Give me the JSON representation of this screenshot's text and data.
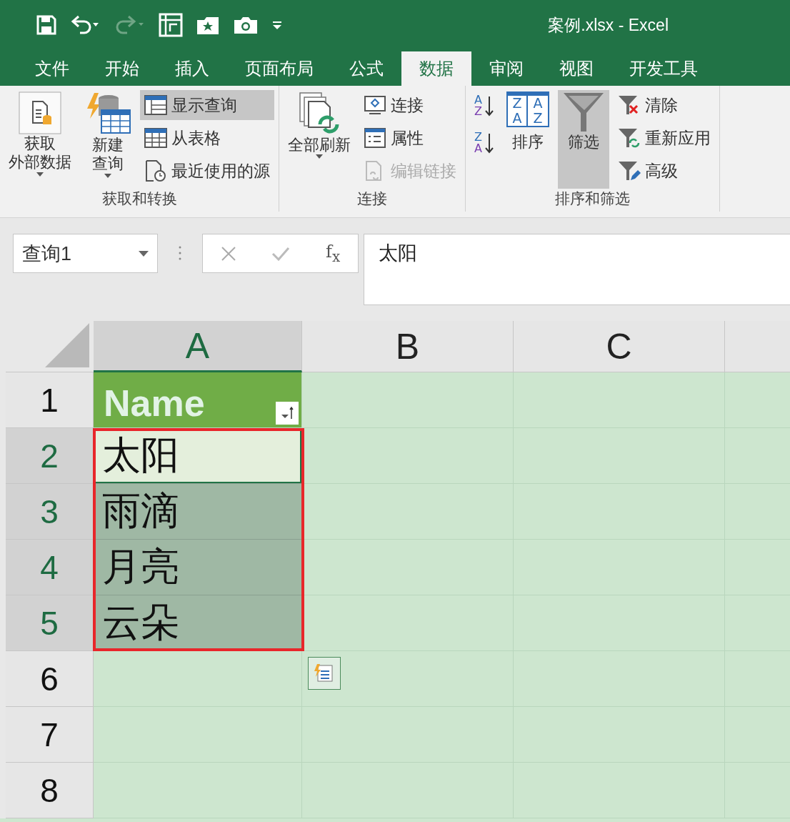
{
  "window": {
    "title": "案例.xlsx - Excel"
  },
  "tabs": [
    {
      "label": "文件",
      "selected": false
    },
    {
      "label": "开始",
      "selected": false
    },
    {
      "label": "插入",
      "selected": false
    },
    {
      "label": "页面布局",
      "selected": false
    },
    {
      "label": "公式",
      "selected": false
    },
    {
      "label": "数据",
      "selected": true
    },
    {
      "label": "审阅",
      "selected": false
    },
    {
      "label": "视图",
      "selected": false
    },
    {
      "label": "开发工具",
      "selected": false
    }
  ],
  "ribbon": {
    "groups": [
      {
        "label": "获取和转换",
        "large": [
          {
            "kind": "external",
            "lines": [
              "获取",
              "外部数据"
            ],
            "dropdown": true
          },
          {
            "kind": "newquery",
            "lines": [
              "新建",
              "查询"
            ],
            "dropdown": true
          }
        ],
        "small": [
          {
            "kind": "showquery",
            "label": "显示查询",
            "pressed": true,
            "disabled": false
          },
          {
            "kind": "fromtable",
            "label": "从表格",
            "pressed": false,
            "disabled": false
          },
          {
            "kind": "recent",
            "label": "最近使用的源",
            "pressed": false,
            "disabled": false
          }
        ]
      },
      {
        "label": "连接",
        "large": [
          {
            "kind": "refresh",
            "lines": [
              "全部刷新"
            ],
            "dropdown": true
          }
        ],
        "small": [
          {
            "kind": "connections",
            "label": "连接",
            "pressed": false,
            "disabled": false
          },
          {
            "kind": "properties",
            "label": "属性",
            "pressed": false,
            "disabled": false
          },
          {
            "kind": "editlinks",
            "label": "编辑链接",
            "pressed": false,
            "disabled": true
          }
        ]
      },
      {
        "label": "排序和筛选",
        "large": [
          {
            "kind": "sortaz",
            "letters": [
              [
                "A",
                "Z"
              ],
              [
                "Z",
                "A"
              ]
            ]
          },
          {
            "kind": "sort",
            "letters": [
              "Z",
              "A",
              "A",
              "Z"
            ],
            "lines": [
              "排序"
            ]
          },
          {
            "kind": "filter",
            "lines": [
              "筛选"
            ],
            "pressed": true
          }
        ],
        "small": [
          {
            "kind": "clear",
            "label": "清除",
            "pressed": false,
            "disabled": false
          },
          {
            "kind": "reapply",
            "label": "重新应用",
            "pressed": false,
            "disabled": false
          },
          {
            "kind": "advanced",
            "label": "高级",
            "pressed": false,
            "disabled": false
          }
        ]
      }
    ]
  },
  "name_box": {
    "value": "查询1"
  },
  "formula_bar": {
    "function_button": "f$_{x}$",
    "value": "太阳"
  },
  "columns": [
    {
      "label": "A",
      "selected": true
    },
    {
      "label": "B",
      "selected": false
    },
    {
      "label": "C",
      "selected": false
    }
  ],
  "rows": [
    {
      "number": "1",
      "selected": false,
      "kind": "header",
      "cell": "Name"
    },
    {
      "number": "2",
      "selected": true,
      "active": true,
      "kind": "data",
      "cell": "太阳"
    },
    {
      "number": "3",
      "selected": true,
      "active": false,
      "kind": "data",
      "cell": "雨滴"
    },
    {
      "number": "4",
      "selected": true,
      "active": false,
      "kind": "data",
      "cell": "月亮"
    },
    {
      "number": "5",
      "selected": true,
      "active": false,
      "kind": "data",
      "cell": "云朵"
    },
    {
      "number": "6",
      "selected": false,
      "kind": "empty"
    },
    {
      "number": "7",
      "selected": false,
      "kind": "empty"
    },
    {
      "number": "8",
      "selected": false,
      "kind": "empty"
    }
  ]
}
